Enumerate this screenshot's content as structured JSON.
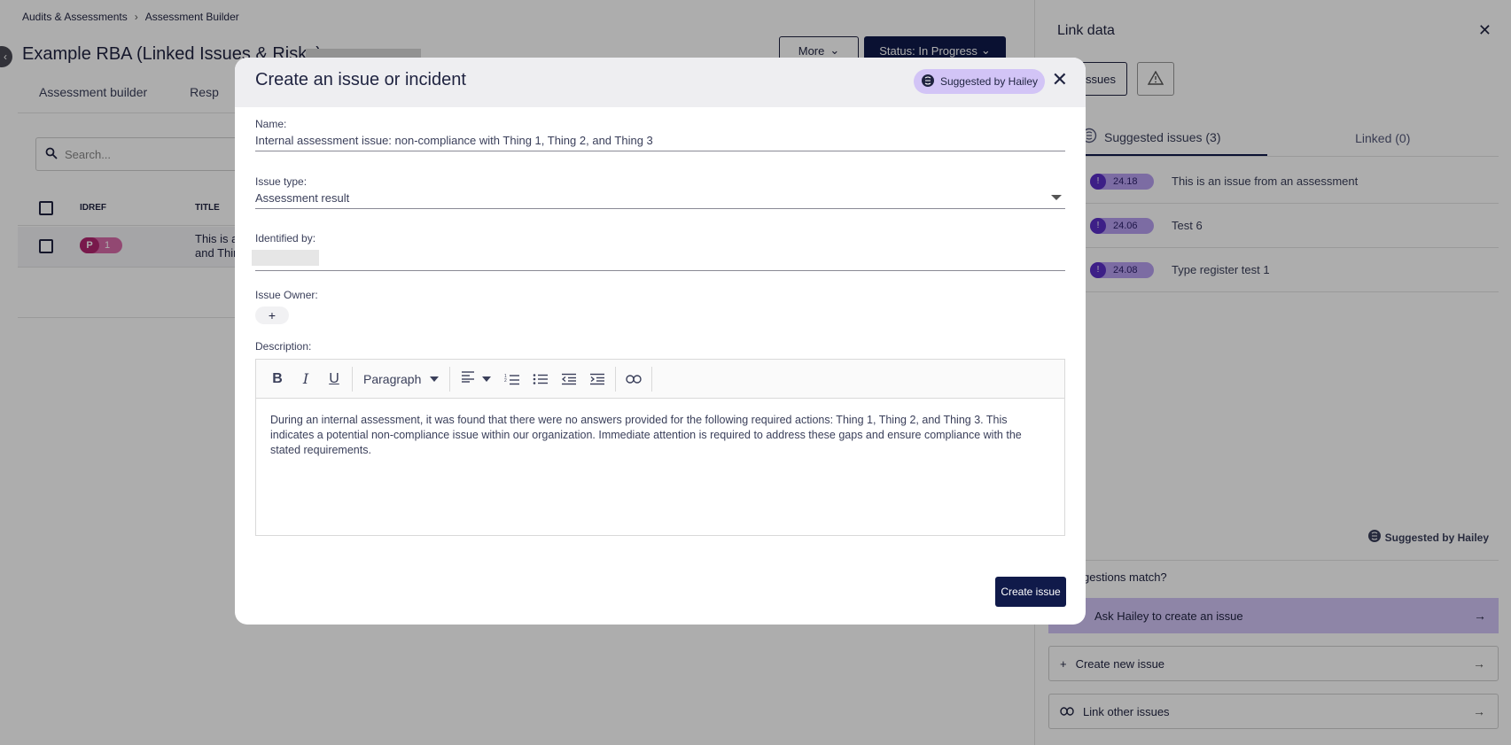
{
  "breadcrumb": {
    "root": "Audits & Assessments",
    "current": "Assessment Builder"
  },
  "page": {
    "title": "Example RBA (Linked Issues & Risks)",
    "more_label": "More",
    "status_label": "Status: In Progress",
    "tabs": [
      "Assessment builder",
      "Resp"
    ],
    "search_placeholder": "Search...",
    "columns": {
      "idref": "IDREF",
      "title": "TITLE"
    },
    "row": {
      "badge_letter": "P",
      "badge_count": "1",
      "title_line1": "This is a",
      "title_line2": "and Thir"
    }
  },
  "panel": {
    "title": "Link data",
    "toggle_label": "ssues",
    "tabs": {
      "suggested": "Suggested issues (3)",
      "linked": "Linked (0)"
    },
    "suggestions": [
      {
        "id": "24.18",
        "title": "This is an issue from an assessment"
      },
      {
        "id": "24.06",
        "title": "Test 6"
      },
      {
        "id": "24.08",
        "title": "Type register test 1"
      }
    ],
    "hailey_note": "Suggested by Hailey",
    "no_match": "gestions match?",
    "ask_label": "Ask Hailey to create an issue",
    "create_new_label": "Create new issue",
    "link_other_label": "Link other issues"
  },
  "modal": {
    "title": "Create an issue or incident",
    "hailey_label": "Suggested by Hailey",
    "name_label": "Name:",
    "name_value": "Internal assessment issue: non-compliance with Thing 1, Thing 2, and Thing 3",
    "issue_type_label": "Issue type:",
    "issue_type_value": "Assessment result",
    "identified_label": "Identified by:",
    "owner_label": "Issue Owner:",
    "owner_add": "+",
    "description_label": "Description:",
    "paragraph_label": "Paragraph",
    "description_text": "During an internal assessment, it was found that there were no answers provided for the following required actions: Thing 1, Thing 2, and Thing 3. This indicates a potential non-compliance issue within our organization. Immediate attention is required to address these gaps and ensure compliance with the stated requirements.",
    "create_label": "Create issue"
  }
}
